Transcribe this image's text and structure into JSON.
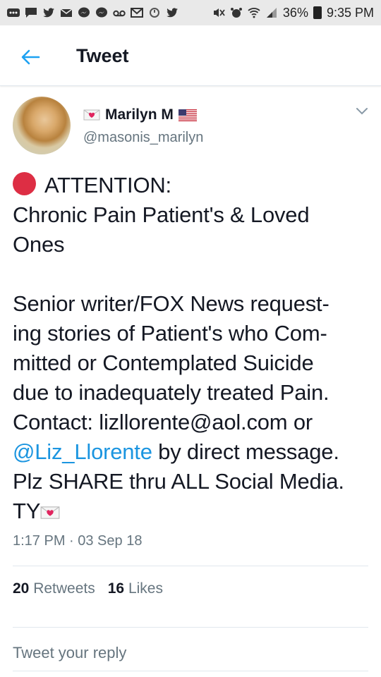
{
  "status_bar": {
    "battery_percent": "36%",
    "time": "9:35 PM",
    "icons": [
      "more-icon",
      "message-icon",
      "twitter-icon",
      "mail-icon",
      "messenger-icon",
      "messenger-icon",
      "voicemail-icon",
      "gmail-icon",
      "sync-icon",
      "twitter-icon",
      "mute-icon",
      "alarm-icon",
      "wifi-icon",
      "signal-icon",
      "battery-icon"
    ]
  },
  "header": {
    "title": "Tweet"
  },
  "author": {
    "name": "Marilyn M",
    "handle": "@masonis_marilyn"
  },
  "tweet": {
    "attention": "ATTENTION:",
    "line2": "Chronic Pain Patient's & Loved",
    "line3": "Ones",
    "body_lines": [
      "Senior writer/FOX News request-",
      "ing stories of Patient's who Com-",
      "mitted or Contemplated Suicide",
      "due to inadequately treated Pain.",
      "Contact: lizllorente@aol.com or"
    ],
    "mention": "@Liz_Llorente",
    "mention_suffix": " by direct message.",
    "line_share": "Plz SHARE thru ALL Social Media.",
    "sign_off": "TY"
  },
  "meta": {
    "timestamp": "1:17 PM · 03 Sep 18"
  },
  "stats": {
    "retweets_count": "20",
    "retweets_label": "Retweets",
    "likes_count": "16",
    "likes_label": "Likes"
  },
  "reply": {
    "placeholder": "Tweet your reply"
  },
  "colors": {
    "link": "#1b95e0",
    "accent": "#1da1f2",
    "red_circle": "#dd2e44"
  }
}
